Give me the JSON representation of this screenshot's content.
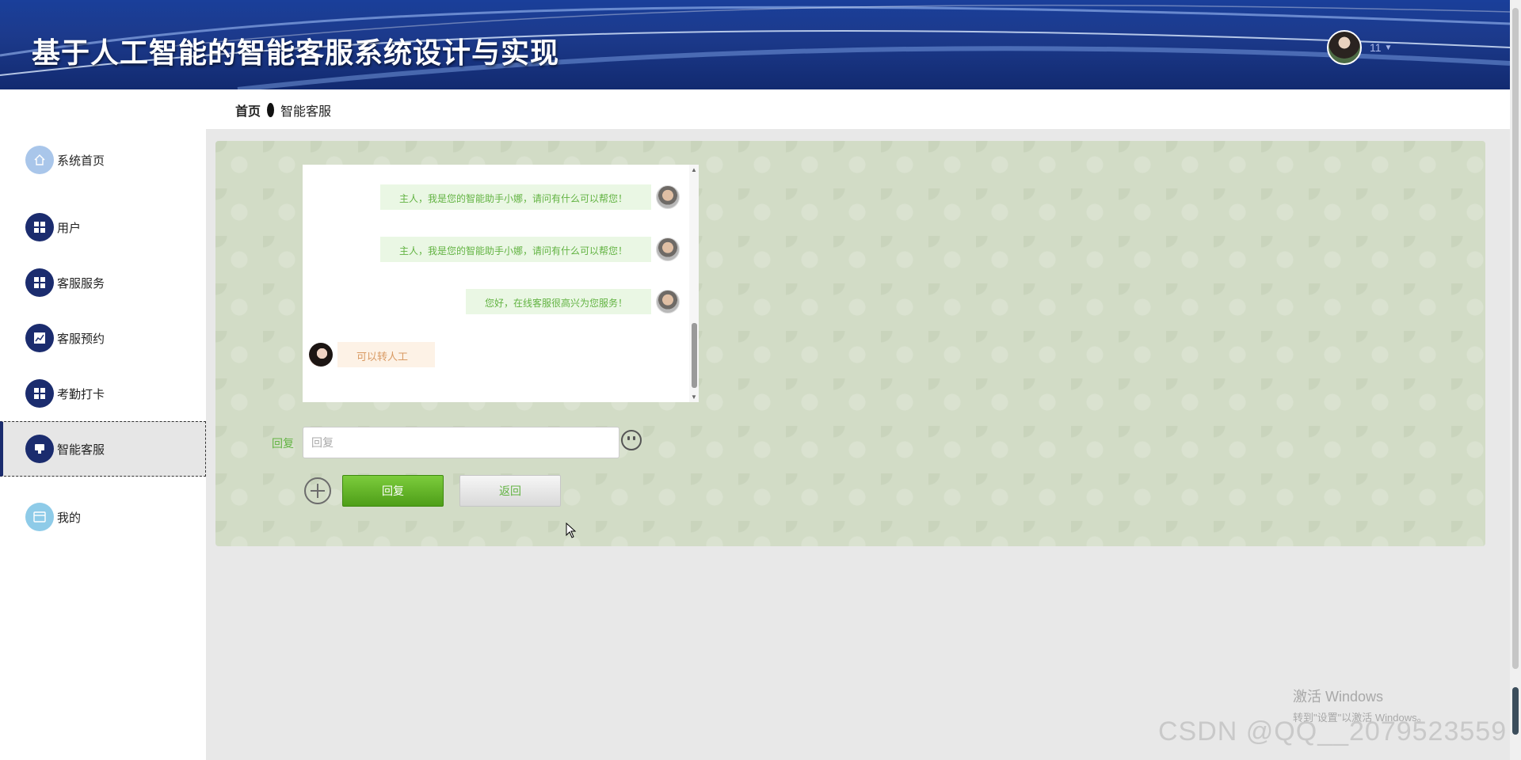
{
  "header": {
    "title": "基于人工智能的智能客服系统设计与实现",
    "user_name": "11",
    "caret_icon": "chevron-down-icon"
  },
  "sidebar": {
    "items": [
      {
        "label": "系统首页",
        "icon": "home-icon"
      },
      {
        "label": "用户",
        "icon": "grid-icon"
      },
      {
        "label": "客服服务",
        "icon": "grid-icon"
      },
      {
        "label": "客服预约",
        "icon": "chart-icon"
      },
      {
        "label": "考勤打卡",
        "icon": "grid-icon"
      },
      {
        "label": "智能客服",
        "icon": "chat-icon",
        "active": true
      },
      {
        "label": "我的",
        "icon": "card-icon"
      }
    ]
  },
  "breadcrumb": {
    "home": "首页",
    "current": "智能客服"
  },
  "chat": {
    "messages": [
      {
        "side": "right",
        "text": "主人，我是您的智能助手小娜，请问有什么可以帮您！"
      },
      {
        "side": "right",
        "text": "主人，我是您的智能助手小娜，请问有什么可以帮您！"
      },
      {
        "side": "right",
        "text": "您好，在线客服很高兴为您服务！"
      },
      {
        "side": "left",
        "text": "可以转人工"
      }
    ]
  },
  "reply": {
    "label": "回复",
    "placeholder": "回复",
    "value": "",
    "submit_label": "回复",
    "back_label": "返回"
  },
  "watermark": {
    "activate_line1": "激活 Windows",
    "activate_line2": "转到\"设置\"以激活 Windows。",
    "csdn": "CSDN @QQ__2079523559"
  },
  "colors": {
    "header_bg": "#1c3a8c",
    "nav_icon": "#1b2c6e",
    "accent_green": "#62b342",
    "panel_bg": "#d2dcc6"
  }
}
